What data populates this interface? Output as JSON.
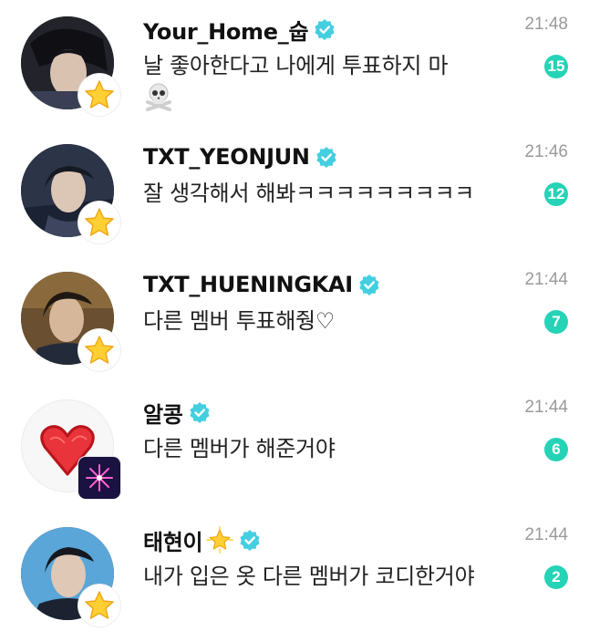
{
  "colors": {
    "verified": "#43cfe0",
    "unread_badge": "#25d3b6",
    "time_text": "#9a9a9a"
  },
  "chats": [
    {
      "name": "Your_Home_숩",
      "name_icon": null,
      "verified_icon": "verified-check-icon",
      "message": "날 좋아한다고 나에게 투표하지 마",
      "message_icon": "skull-crossbones-icon",
      "time": "21:48",
      "unread": "15",
      "avatar_badge_icon": "star-icon"
    },
    {
      "name": "TXT_YEONJUN",
      "name_icon": null,
      "verified_icon": "verified-check-icon",
      "message": "잘 생각해서 해봐ㅋㅋㅋㅋㅋㅋㅋㅋㅋ",
      "message_icon": null,
      "time": "21:46",
      "unread": "12",
      "avatar_badge_icon": "star-icon"
    },
    {
      "name": "TXT_HUENINGKAI",
      "name_icon": null,
      "verified_icon": "verified-check-icon",
      "message": "다른 멤버 투표해줭♡",
      "message_icon": null,
      "time": "21:44",
      "unread": "7",
      "avatar_badge_icon": "star-icon"
    },
    {
      "name": "알콩",
      "name_icon": null,
      "verified_icon": "verified-check-icon",
      "message": "다른 멤버가 해준거야",
      "message_icon": null,
      "time": "21:44",
      "unread": "6",
      "avatar_badge_icon": "firework-icon"
    },
    {
      "name": "태현이",
      "name_icon": "glowing-star-icon",
      "verified_icon": "verified-check-icon",
      "message": "내가 입은 옷 다른 멤버가 코디한거야",
      "message_icon": null,
      "time": "21:44",
      "unread": "2",
      "avatar_badge_icon": "star-icon"
    }
  ]
}
